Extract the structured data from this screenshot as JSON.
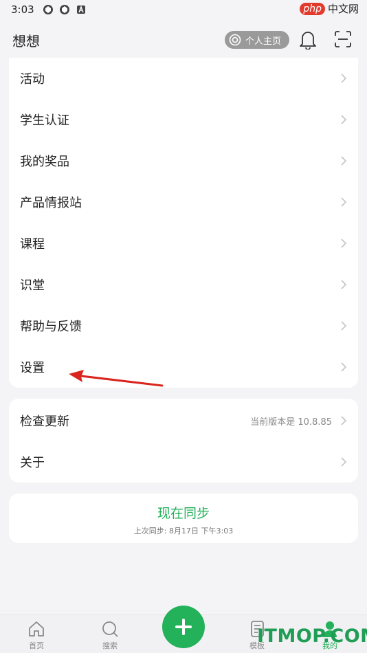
{
  "status_bar": {
    "time": "3:03"
  },
  "watermark_top": {
    "php": "php",
    "cn": "中文网"
  },
  "header": {
    "title": "想想",
    "profile_label": "个人主页"
  },
  "menu_group_1": [
    {
      "label": "活动"
    },
    {
      "label": "学生认证"
    },
    {
      "label": "我的奖品"
    },
    {
      "label": "产品情报站"
    },
    {
      "label": "课程"
    },
    {
      "label": "识堂"
    },
    {
      "label": "帮助与反馈"
    },
    {
      "label": "设置"
    }
  ],
  "menu_group_2": [
    {
      "label": "检查更新",
      "sub": "当前版本是 10.8.85"
    },
    {
      "label": "关于"
    }
  ],
  "sync": {
    "title": "现在同步",
    "subtitle": "上次同步: 8月17日 下午3:03"
  },
  "tabs": {
    "home": "首页",
    "search": "搜索",
    "template": "模板",
    "mine": "我的"
  },
  "watermark_bottom": "ITMOP.COM",
  "colors": {
    "accent": "#23b15a",
    "annotation_arrow": "#d9251d"
  }
}
